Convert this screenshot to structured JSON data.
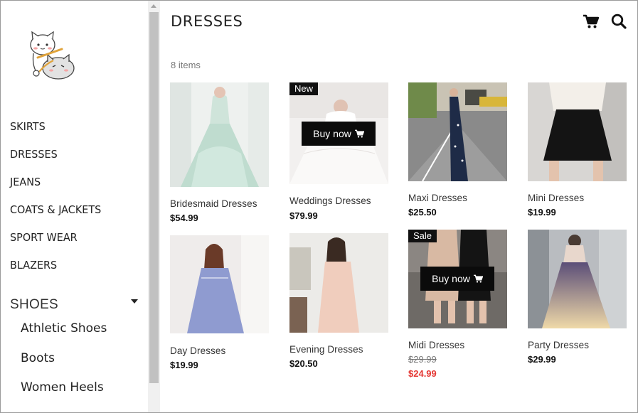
{
  "page": {
    "title": "DRESSES",
    "count": "8 items"
  },
  "colors": {
    "sale": "#e53935",
    "badge_bg": "#111111",
    "accent": "#000000"
  },
  "sidebar": {
    "categories": [
      "SKIRTS",
      "DRESSES",
      "JEANS",
      "COATS & JACKETS",
      "SPORT WEAR",
      "BLAZERS"
    ],
    "shoes": {
      "label": "SHOES",
      "items": [
        "Athletic Shoes",
        "Boots",
        "Women Heels"
      ]
    }
  },
  "header": {
    "icons": [
      "cart-icon",
      "search-icon"
    ]
  },
  "products": [
    {
      "name": "Bridesmaid Dresses",
      "price": "$54.99"
    },
    {
      "name": "Weddings Dresses",
      "price": "$79.99",
      "badge": "New",
      "buy_label": "Buy now"
    },
    {
      "name": "Maxi Dresses",
      "price": "$25.50"
    },
    {
      "name": "Mini Dresses",
      "price": "$19.99"
    },
    {
      "name": "Day Dresses",
      "price": "$19.99"
    },
    {
      "name": "Evening Dresses",
      "price": "$20.50"
    },
    {
      "name": "Midi Dresses",
      "old_price": "$29.99",
      "price": "$24.99",
      "badge": "Sale",
      "buy_label": "Buy now"
    },
    {
      "name": "Party Dresses",
      "price": "$29.99"
    }
  ]
}
